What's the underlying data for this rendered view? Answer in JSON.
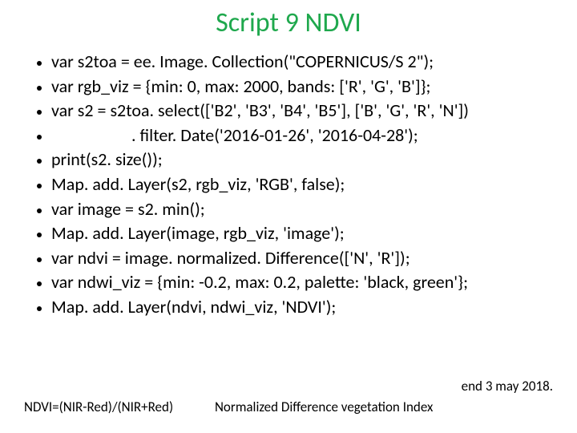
{
  "title": "Script 9 NDVI",
  "code": {
    "l1": "var s2toa = ee. Image. Collection(\"COPERNICUS/S 2\");",
    "l2": "var rgb_viz = {min: 0, max: 2000, bands: ['R', 'G', 'B']};",
    "l3": "var s2 = s2toa. select(['B2', 'B3', 'B4', 'B5'], ['B', 'G', 'R', 'N'])",
    "l4": ". filter. Date('2016-01-26', '2016-04-28');",
    "l5": "print(s2. size());",
    "l6": "Map. add. Layer(s2, rgb_viz, 'RGB', false);",
    "l7": "var image = s2. min();",
    "l8": "Map. add. Layer(image, rgb_viz, 'image');",
    "l9": "var ndvi = image. normalized. Difference(['N', 'R']);",
    "l10": "var ndwi_viz = {min: -0.2, max: 0.2, palette: 'black, green'};",
    "l11": "Map. add. Layer(ndvi, ndwi_viz, 'NDVI');"
  },
  "footer": {
    "formula": "NDVI=(NIR-Red)/(NIR+Red)",
    "caption": "Normalized Difference vegetation Index",
    "date": "end 3 may 2018."
  }
}
